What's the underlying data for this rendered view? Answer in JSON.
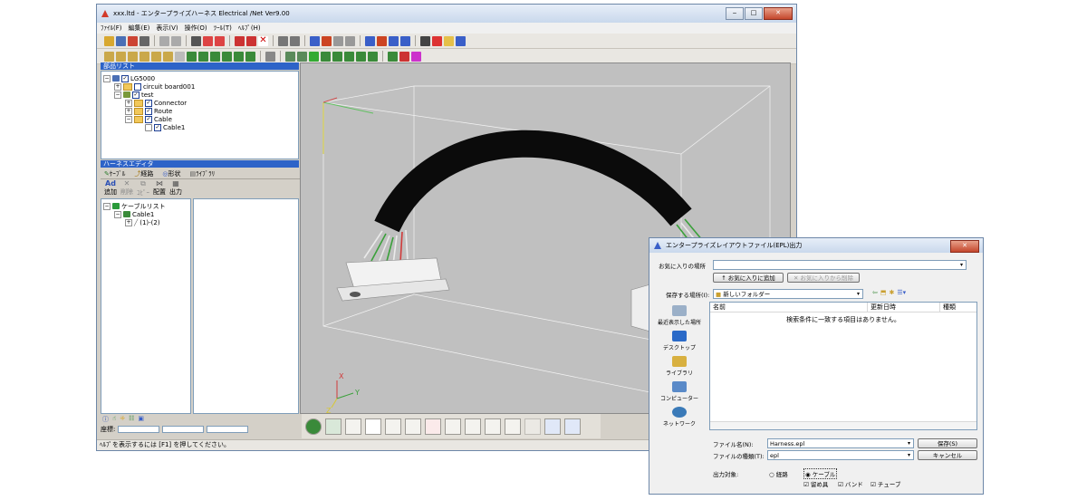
{
  "main_window": {
    "title": "xxx.ltd - エンタープライズハーネス Electrical /Net Ver9.00",
    "menu": [
      "ﾌｧｲﾙ(F)",
      "編集(E)",
      "表示(V)",
      "操作(O)",
      "ﾂｰﾙ(T)",
      "ﾍﾙﾌﾟ(H)"
    ],
    "parts_list": {
      "header": "部品リスト",
      "items": [
        "LG5000",
        "circuit board001",
        "test",
        "Connector",
        "Route",
        "Cable",
        "Cable1"
      ]
    },
    "harness_editor": {
      "header": "ハーネスエディタ",
      "tabs": [
        "ｹｰﾌﾞﾙ",
        "経路",
        "形状",
        "ﾗｲﾌﾞﾗﾘ"
      ],
      "tools": [
        "追加",
        "削除",
        "ｺﾋﾟｰ",
        "配置",
        "出力"
      ],
      "tree": [
        "ケーブルリスト",
        "Cable1",
        "(1)-(2)"
      ],
      "coord_label": "座標:"
    },
    "status_text": "ﾍﾙﾌﾟを表示するには [F1] を押してください。",
    "axis_labels": {
      "x": "X",
      "y": "Y",
      "z": "Z"
    }
  },
  "dialog": {
    "title": "エンタープライズレイアウトファイル(EPL)出力",
    "favorites_label": "お気に入りの場所",
    "add_favorite": "お気に入りに追加",
    "remove_favorite": "お気に入りから削除",
    "save_in_label": "保存する場所(I):",
    "save_in_value": "新しいフォルダー",
    "columns": [
      "名前",
      "更新日時",
      "種類"
    ],
    "empty_message": "検索条件に一致する項目はありません。",
    "places": [
      "最近表示した場所",
      "デスクトップ",
      "ライブラリ",
      "コンピューター",
      "ネットワーク"
    ],
    "filename_label": "ファイル名(N):",
    "filename_value": "Harness.epl",
    "filetype_label": "ファイルの種類(T):",
    "filetype_value": "epl",
    "save_button": "保存(S)",
    "cancel_button": "キャンセル",
    "output_label": "出力対象:",
    "radio_route": "経路",
    "radio_cable": "ケーブル",
    "check_fastener": "留め具",
    "check_band": "バンド",
    "check_tube": "チューブ"
  }
}
